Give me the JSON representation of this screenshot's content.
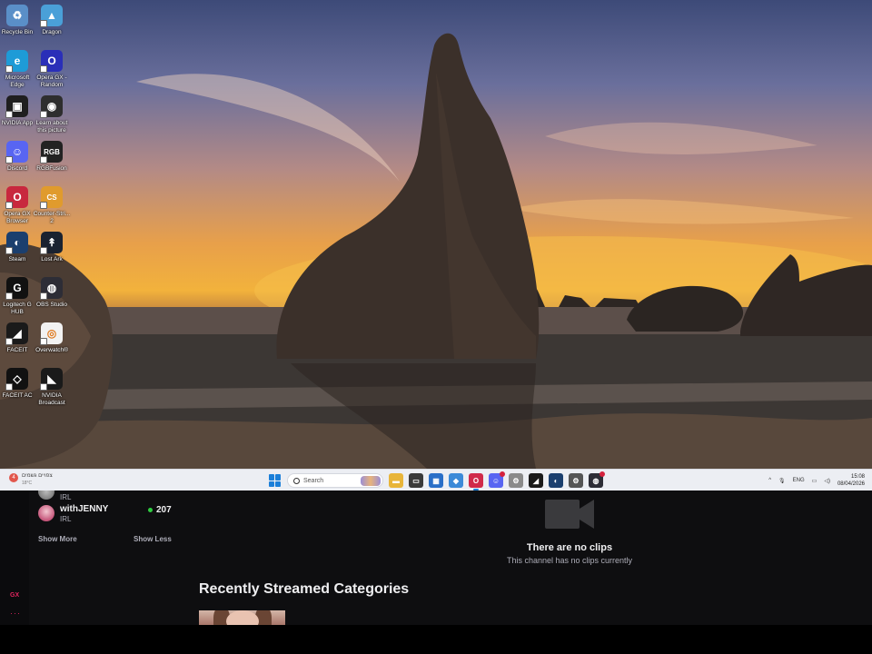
{
  "desktop": {
    "icons": [
      {
        "label": "Recycle Bin",
        "icon": "recycle-bin-icon",
        "color": "#5a8fc8",
        "glyph": "♻"
      },
      {
        "label": "Dragon",
        "icon": "dragon-icon",
        "color": "#4aa0d8",
        "glyph": "▲"
      },
      {
        "label": "Microsoft\nEdge",
        "icon": "edge-icon",
        "color": "#1e9bd7",
        "glyph": "e"
      },
      {
        "label": "Opera GX -\nRandom",
        "icon": "opera-gx-icon",
        "color": "#2a2fb8",
        "glyph": "O"
      },
      {
        "label": "NVIDIA App",
        "icon": "nvidia-icon",
        "color": "#1f1f1f",
        "glyph": "▣"
      },
      {
        "label": "Learn about\nthis picture",
        "icon": "learn-picture-icon",
        "color": "#2e2e2e",
        "glyph": "◉"
      },
      {
        "label": "Discord",
        "icon": "discord-icon",
        "color": "#5865f2",
        "glyph": "☺"
      },
      {
        "label": "RGBFusion",
        "icon": "rgbfusion-icon",
        "color": "#222",
        "glyph": "RGB"
      },
      {
        "label": "Opera GX\nBrowser",
        "icon": "opera-gx-browser-icon",
        "color": "#c8283e",
        "glyph": "O"
      },
      {
        "label": "Counter-Stri...\n2",
        "icon": "counter-strike-icon",
        "color": "#e09b2d",
        "glyph": "CS"
      },
      {
        "label": "Steam",
        "icon": "steam-icon",
        "color": "#1b3f6e",
        "glyph": "◐"
      },
      {
        "label": "Lost Ark",
        "icon": "lost-ark-icon",
        "color": "#1a2230",
        "glyph": "↟"
      },
      {
        "label": "Logitech G\nHUB",
        "icon": "logitech-ghub-icon",
        "color": "#111",
        "glyph": "G"
      },
      {
        "label": "OBS Studio",
        "icon": "obs-studio-icon",
        "color": "#2d2d36",
        "glyph": "◍"
      },
      {
        "label": "FACEIT",
        "icon": "faceit-icon",
        "color": "#1a1a1a",
        "glyph": "◢"
      },
      {
        "label": "Overwatch®",
        "icon": "overwatch-icon",
        "color": "#f2f2f2",
        "glyph": "◎"
      },
      {
        "label": "FACEIT AC",
        "icon": "faceit-ac-icon",
        "color": "#111",
        "glyph": "◇"
      },
      {
        "label": "NVIDIA\nBroadcast",
        "icon": "nvidia-broadcast-icon",
        "color": "#1a1a1a",
        "glyph": "◣"
      }
    ]
  },
  "taskbar": {
    "weather_line1": "צפויים גשמים",
    "weather_line2": "18°C",
    "weather_badge": "4",
    "search_placeholder": "Search",
    "apps": [
      {
        "name": "file-explorer-icon",
        "color": "#e8b53a",
        "glyph": "▬"
      },
      {
        "name": "task-view-icon",
        "color": "#3a3a3a",
        "glyph": "▭"
      },
      {
        "name": "ms-store-icon",
        "color": "#2a6fc8",
        "glyph": "▦"
      },
      {
        "name": "copilot-icon",
        "color": "#3c8ad8",
        "glyph": "◆"
      },
      {
        "name": "opera-gx-taskbar-icon",
        "color": "#d02a4a",
        "glyph": "O"
      },
      {
        "name": "discord-taskbar-icon",
        "color": "#5865f2",
        "glyph": "☺"
      },
      {
        "name": "settings-icon",
        "color": "#8a8a8a",
        "glyph": "⚙"
      },
      {
        "name": "faceit-taskbar-icon",
        "color": "#1a1a1a",
        "glyph": "◢"
      },
      {
        "name": "steam-taskbar-icon",
        "color": "#1b3f6e",
        "glyph": "◐"
      },
      {
        "name": "logitech-taskbar-icon",
        "color": "#555",
        "glyph": "⚙"
      },
      {
        "name": "obs-taskbar-icon",
        "color": "#2d2d36",
        "glyph": "◍"
      }
    ],
    "tray_lang": "ENG",
    "clock_time": "15:08",
    "clock_date": "08/04/2026"
  },
  "page": {
    "prev_channel_category": "IRL",
    "channel": {
      "name": "withJENNY",
      "category": "IRL",
      "viewers": "207"
    },
    "show_more": "Show More",
    "show_less": "Show Less",
    "no_clips_title": "There are no clips",
    "no_clips_subtitle": "This channel has no clips currently",
    "recently_streamed_title": "Recently Streamed Categories",
    "gx_label": "GX",
    "more_label": "···"
  }
}
